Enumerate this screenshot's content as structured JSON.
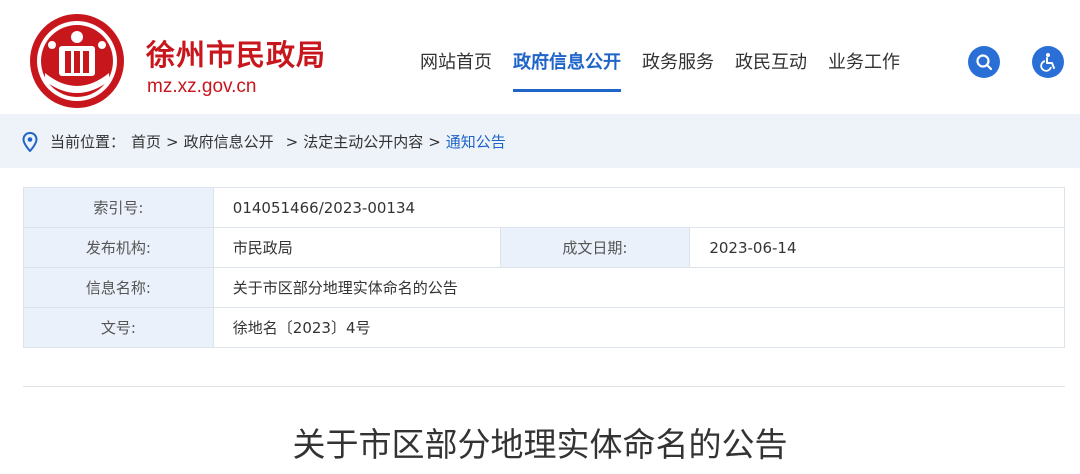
{
  "header": {
    "site_name": "徐州市民政局",
    "site_domain": "mz.xz.gov.cn",
    "brand_color": "#c8161d",
    "accent_color": "#1f64c8"
  },
  "nav": {
    "items": [
      {
        "label": "网站首页"
      },
      {
        "label": "政府信息公开",
        "active": true
      },
      {
        "label": "政务服务"
      },
      {
        "label": "政民互动"
      },
      {
        "label": "业务工作"
      }
    ],
    "search_icon": "search-icon",
    "accessibility_icon": "wheelchair-icon"
  },
  "breadcrumb": {
    "prefix": "当前位置：",
    "items": [
      "首页",
      "政府信息公开",
      "法定主动公开内容",
      "通知公告"
    ],
    "separator": ">"
  },
  "info": {
    "index_label": "索引号:",
    "index_value": "014051466/2023-00134",
    "publisher_label": "发布机构:",
    "publisher_value": "市民政局",
    "date_label": "成文日期:",
    "date_value": "2023-06-14",
    "name_label": "信息名称:",
    "name_value": "关于市区部分地理实体命名的公告",
    "doc_no_label": "文号:",
    "doc_no_value": "徐地名〔2023〕4号"
  },
  "article": {
    "title": "关于市区部分地理实体命名的公告"
  }
}
